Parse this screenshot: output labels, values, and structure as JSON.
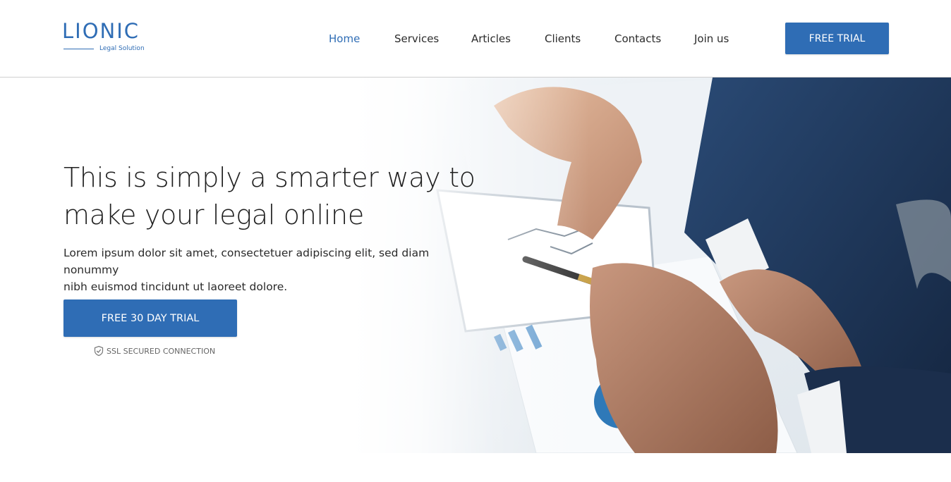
{
  "header": {
    "logo": {
      "name": "LIONIC",
      "tagline": "Legal Solution"
    },
    "nav": [
      {
        "label": "Home",
        "active": true
      },
      {
        "label": "Services",
        "active": false
      },
      {
        "label": "Articles",
        "active": false
      },
      {
        "label": "Clients",
        "active": false
      },
      {
        "label": "Contacts",
        "active": false
      },
      {
        "label": "Join us",
        "active": false
      }
    ],
    "cta_label": "FREE TRIAL"
  },
  "hero": {
    "headline_line1": "This is simply a smarter way to",
    "headline_line2": "make your legal online",
    "subtext_line1": "Lorem ipsum dolor sit amet, consectetuer adipiscing elit, sed diam nonummy",
    "subtext_line2": "nibh euismod tincidunt ut laoreet dolore.",
    "cta_label": "FREE 30 DAY TRIAL",
    "ssl_icon": "shield-check-icon",
    "ssl_label": "SSL SECURED CONNECTION",
    "image": "business-hands-tablet-photo"
  },
  "colors": {
    "accent": "#2f6db5",
    "text_dark": "#1f1f1f",
    "suit_navy": "#1d3557"
  }
}
